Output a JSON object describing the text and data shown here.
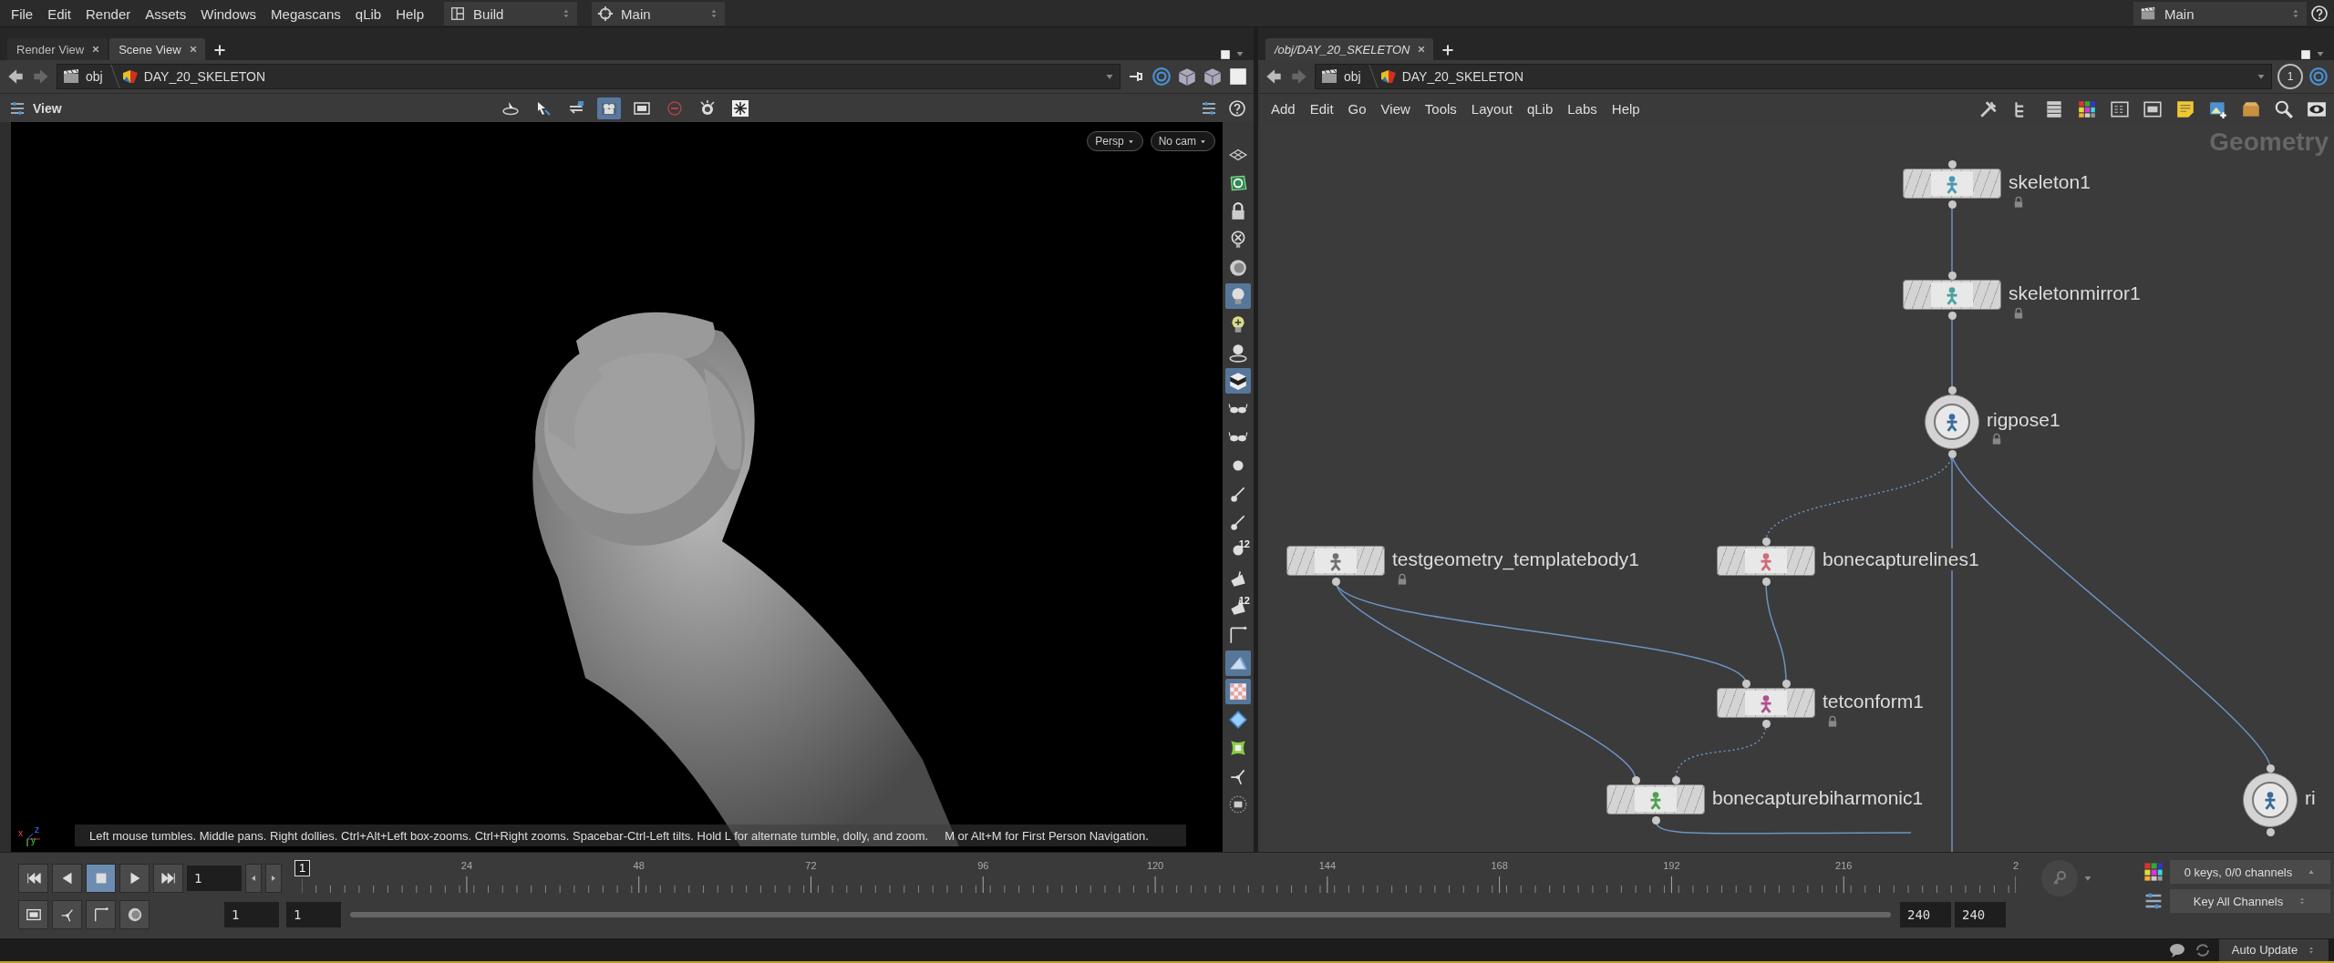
{
  "menu": [
    "File",
    "Edit",
    "Render",
    "Assets",
    "Windows",
    "Megascans",
    "qLib",
    "Help"
  ],
  "desktops": [
    {
      "kind": "layout",
      "label": "Build"
    },
    {
      "kind": "target",
      "label": "Main"
    }
  ],
  "right_desktop": {
    "label": "Main"
  },
  "scene_pane": {
    "tabs": [
      {
        "label": "Render View",
        "selected": false
      },
      {
        "label": "Scene View",
        "selected": true
      }
    ],
    "path": [
      "obj",
      "DAY_20_SKELETON"
    ],
    "toolbar_title": "View",
    "view_tools": [
      {
        "kind": "rotate",
        "selected": false
      },
      {
        "kind": "select",
        "selected": false
      },
      {
        "kind": "transform",
        "selected": false
      },
      {
        "kind": "camera",
        "selected": true
      },
      {
        "kind": "display",
        "selected": false
      },
      {
        "kind": "disabled",
        "selected": false
      },
      {
        "kind": "light",
        "selected": false
      },
      {
        "kind": "snowflake",
        "selected": false
      }
    ],
    "camera_menus": [
      "Persp",
      "No cam"
    ],
    "axes": [
      "x",
      "z",
      "y"
    ],
    "hints": [
      "Left mouse tumbles. Middle pans. Right dollies. Ctrl+Alt+Left box-zooms. Ctrl+Right zooms. Spacebar-Ctrl-Left tilts. Hold L for alternate tumble, dolly, and zoom.",
      "M or Alt+M for First Person Navigation."
    ],
    "side_tools": [
      {
        "kind": "plane",
        "selected": false
      },
      {
        "kind": "texture",
        "selected": false
      },
      {
        "kind": "lock",
        "selected": false
      },
      {
        "kind": "light-off",
        "selected": false
      },
      {
        "kind": "dial",
        "selected": false
      },
      {
        "kind": "light",
        "selected": true
      },
      {
        "kind": "light-add",
        "selected": false
      },
      {
        "kind": "light-target",
        "selected": false
      },
      {
        "kind": "shading",
        "selected": true
      },
      {
        "kind": "stereo",
        "selected": false
      },
      {
        "kind": "stereo",
        "selected": false
      },
      {
        "kind": "point",
        "selected": false
      },
      {
        "kind": "pin",
        "selected": false
      },
      {
        "kind": "pin",
        "selected": false
      },
      {
        "kind": "point",
        "selected": false,
        "label": "12"
      },
      {
        "kind": "face",
        "selected": false
      },
      {
        "kind": "face",
        "selected": false,
        "label": "12"
      },
      {
        "kind": "edge",
        "selected": false
      },
      {
        "kind": "wedge",
        "selected": true
      },
      {
        "kind": "checker",
        "selected": true
      },
      {
        "kind": "diamond",
        "selected": false
      },
      {
        "kind": "guide",
        "selected": false
      },
      {
        "kind": "tripod",
        "selected": false
      },
      {
        "kind": "menu",
        "selected": false
      }
    ]
  },
  "network_pane": {
    "tabs": [
      {
        "label": "/obj/DAY_20_SKELETON",
        "selected": true
      }
    ],
    "path": [
      "obj",
      "DAY_20_SKELETON"
    ],
    "view_number": "1",
    "menu": [
      "Add",
      "Edit",
      "Go",
      "View",
      "Tools",
      "Layout",
      "qLib",
      "Labs",
      "Help"
    ],
    "context_label": "Geometry",
    "nodes": [
      {
        "name": "skeleton1",
        "kind": "box",
        "color": "#4a9ab0",
        "locked": true
      },
      {
        "name": "skeletonmirror1",
        "kind": "box",
        "color": "#4aa0a0",
        "locked": true
      },
      {
        "name": "rigpose1",
        "kind": "circle",
        "color": "#3a6a9a",
        "locked": true
      },
      {
        "name": "testgeometry_templatebody1",
        "kind": "box",
        "color": "#707070",
        "locked": true
      },
      {
        "name": "bonecapturelines1",
        "kind": "box",
        "color": "#d06a7a",
        "locked": false
      },
      {
        "name": "tetconform1",
        "kind": "box",
        "color": "#b05090",
        "locked": true
      },
      {
        "name": "bonecapturebiharmonic1",
        "kind": "box",
        "color": "#50a050",
        "locked": false
      },
      {
        "name": "ri",
        "kind": "circle",
        "color": "#3a6a9a",
        "locked": false
      }
    ]
  },
  "timeline": {
    "transport": [
      {
        "kind": "first",
        "selected": false
      },
      {
        "kind": "back",
        "selected": false
      },
      {
        "kind": "stop",
        "selected": true
      },
      {
        "kind": "play",
        "selected": false
      },
      {
        "kind": "last",
        "selected": false
      }
    ],
    "frame_field": "1",
    "current_frame": "1",
    "tick_labels": [
      "24",
      "48",
      "72",
      "96",
      "120",
      "144",
      "168",
      "192",
      "216",
      "2"
    ],
    "start_fields": [
      "1",
      "1"
    ],
    "end_fields": [
      "240",
      "240"
    ],
    "keys": "0 keys, 0/0 channels",
    "key_mode": "Key All Channels"
  },
  "status": {
    "update_mode": "Auto Update"
  }
}
